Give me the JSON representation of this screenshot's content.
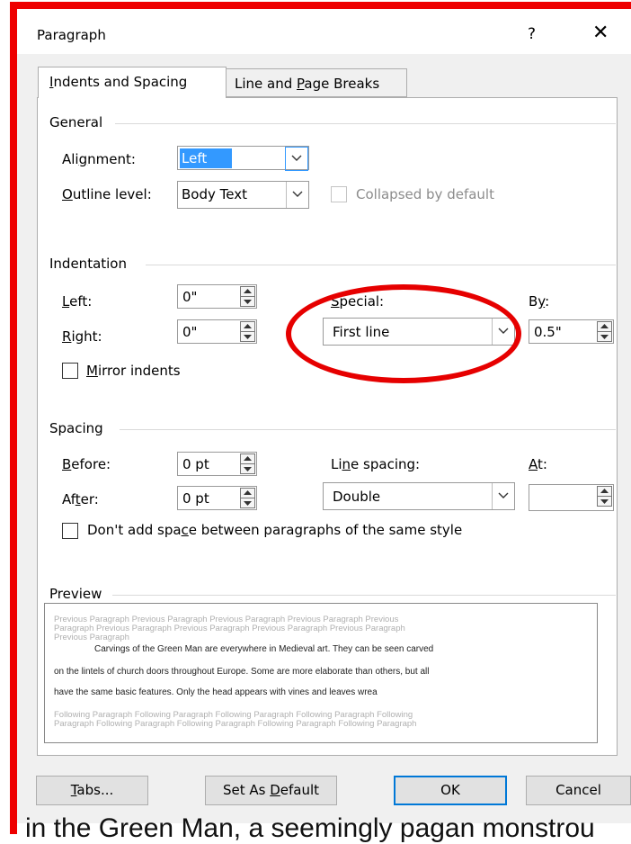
{
  "dialog": {
    "title": "Paragraph",
    "help": "?",
    "close": "✕"
  },
  "tabs": [
    {
      "label_pre": "",
      "label_ul": "I",
      "label_post": "ndents and Spacing",
      "active": true
    },
    {
      "label_pre": "Line and ",
      "label_ul": "P",
      "label_post": "age Breaks",
      "active": false
    }
  ],
  "general": {
    "heading": "General",
    "alignment_label": {
      "pre": "Ali",
      "ul": "g",
      "post": "nment:"
    },
    "alignment_value": "Left",
    "outline_label": {
      "pre": "",
      "ul": "O",
      "post": "utline level:"
    },
    "outline_value": "Body Text",
    "collapsed_label": "Collapsed by default"
  },
  "indentation": {
    "heading": "Indentation",
    "left_label": {
      "pre": "",
      "ul": "L",
      "post": "eft:"
    },
    "left_value": "0\"",
    "right_label": {
      "pre": "",
      "ul": "R",
      "post": "ight:"
    },
    "right_value": "0\"",
    "special_label": {
      "pre": "",
      "ul": "S",
      "post": "pecial:"
    },
    "special_value": "First line",
    "by_label": {
      "pre": "B",
      "ul": "y",
      "post": ":"
    },
    "by_value": "0.5\"",
    "mirror_label": {
      "pre": "",
      "ul": "M",
      "post": "irror indents"
    }
  },
  "spacing": {
    "heading": "Spacing",
    "before_label": {
      "pre": "",
      "ul": "B",
      "post": "efore:"
    },
    "before_value": "0 pt",
    "after_label": {
      "pre": "Af",
      "ul": "t",
      "post": "er:"
    },
    "after_value": "0 pt",
    "line_spacing_label": {
      "pre": "Li",
      "ul": "n",
      "post": "e spacing:"
    },
    "line_spacing_value": "Double",
    "at_label": {
      "pre": "",
      "ul": "A",
      "post": "t:"
    },
    "at_value": "",
    "dont_add_label": {
      "pre": "Don't add spa",
      "ul": "c",
      "post": "e between paragraphs of the same style"
    }
  },
  "preview": {
    "heading": "Preview",
    "previous_lines": [
      "Previous Paragraph Previous Paragraph Previous Paragraph Previous Paragraph Previous",
      "Paragraph Previous Paragraph Previous Paragraph Previous Paragraph Previous Paragraph",
      "Previous Paragraph"
    ],
    "sample_lines": [
      "Carvings of the Green Man are everywhere in Medieval art. They can be seen carved",
      "on the lintels of church doors throughout Europe. Some are more elaborate than others, but all",
      "have the same basic features. Only the head appears with vines and leaves wrea"
    ],
    "following_lines": [
      "Following Paragraph Following Paragraph Following Paragraph Following Paragraph Following",
      "Paragraph Following Paragraph Following Paragraph Following Paragraph Following Paragraph"
    ]
  },
  "buttons": {
    "tabs": {
      "pre": "",
      "ul": "T",
      "post": "abs..."
    },
    "set_default": {
      "pre": "Set As ",
      "ul": "D",
      "post": "efault"
    },
    "ok": "OK",
    "cancel": "Cancel"
  },
  "background_text": "in the Green Man, a seemingly pagan monstrou",
  "colors": {
    "annotation_red": "#e60000",
    "selection_blue": "#3399ff",
    "dialog_bg": "#f0f0f0"
  },
  "icons": [
    "help-icon",
    "close-icon",
    "chevron-down-icon",
    "spin-up-icon",
    "spin-down-icon"
  ]
}
